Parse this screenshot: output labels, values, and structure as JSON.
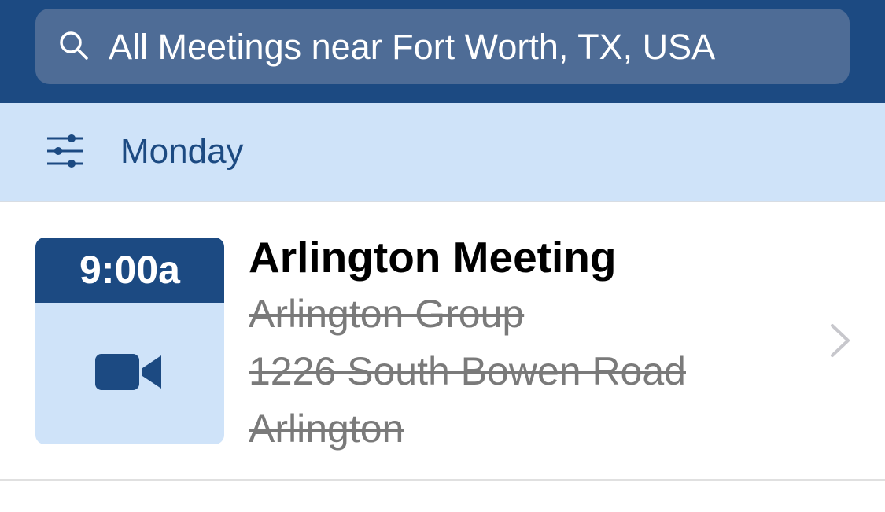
{
  "search": {
    "text": "All Meetings near Fort Worth, TX, USA",
    "icon": "search-icon"
  },
  "filter": {
    "icon": "sliders-icon",
    "day": "Monday"
  },
  "meetings": [
    {
      "time": "9:00a",
      "type_icon": "video-camera-icon",
      "title": "Arlington Meeting",
      "group": "Arlington Group",
      "address": "1226 South Bowen Road",
      "city": "Arlington",
      "location_struck": true
    }
  ],
  "colors": {
    "brand_dark": "#1c4a82",
    "search_bg": "#4e6c96",
    "light_blue": "#cfe3f9",
    "struck_text": "#7a7a7a"
  }
}
